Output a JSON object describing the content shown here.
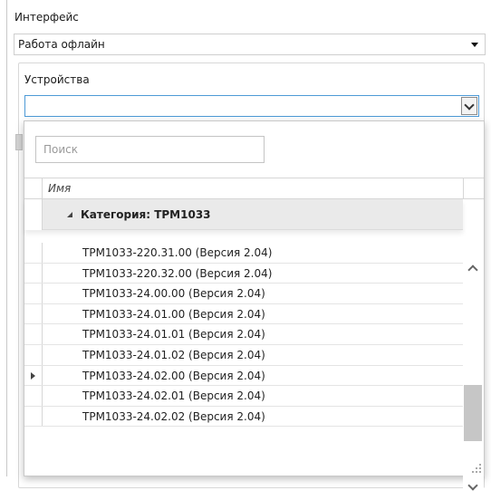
{
  "interface": {
    "label": "Интерфейс",
    "selected": "Работа офлайн"
  },
  "devices": {
    "label": "Устройства",
    "combo_value": ""
  },
  "popup": {
    "search_placeholder": "Поиск",
    "column_name": "Имя",
    "category": {
      "label": "Категория: ТРМ1033",
      "expanded": true
    },
    "items": [
      "ТРМ1033-220.31.00 (Версия 2.04)",
      "ТРМ1033-220.32.00 (Версия 2.04)",
      "ТРМ1033-24.00.00 (Версия 2.04)",
      "ТРМ1033-24.01.00 (Версия 2.04)",
      "ТРМ1033-24.01.01 (Версия 2.04)",
      "ТРМ1033-24.01.02 (Версия 2.04)",
      "ТРМ1033-24.02.00 (Версия 2.04)",
      "ТРМ1033-24.02.01 (Версия 2.04)",
      "ТРМ1033-24.02.02 (Версия 2.04)"
    ],
    "current_row_index": 6
  },
  "icons": {
    "interface_dropdown": "triangle-down-icon",
    "devices_dropdown": "chevron-down-icon",
    "category_toggle": "expand-triangle-icon",
    "row_pointer": "row-pointer-icon",
    "scroll_up": "chevron-up-icon",
    "scroll_down": "chevron-down-icon",
    "resize": "resize-grip-icon"
  }
}
